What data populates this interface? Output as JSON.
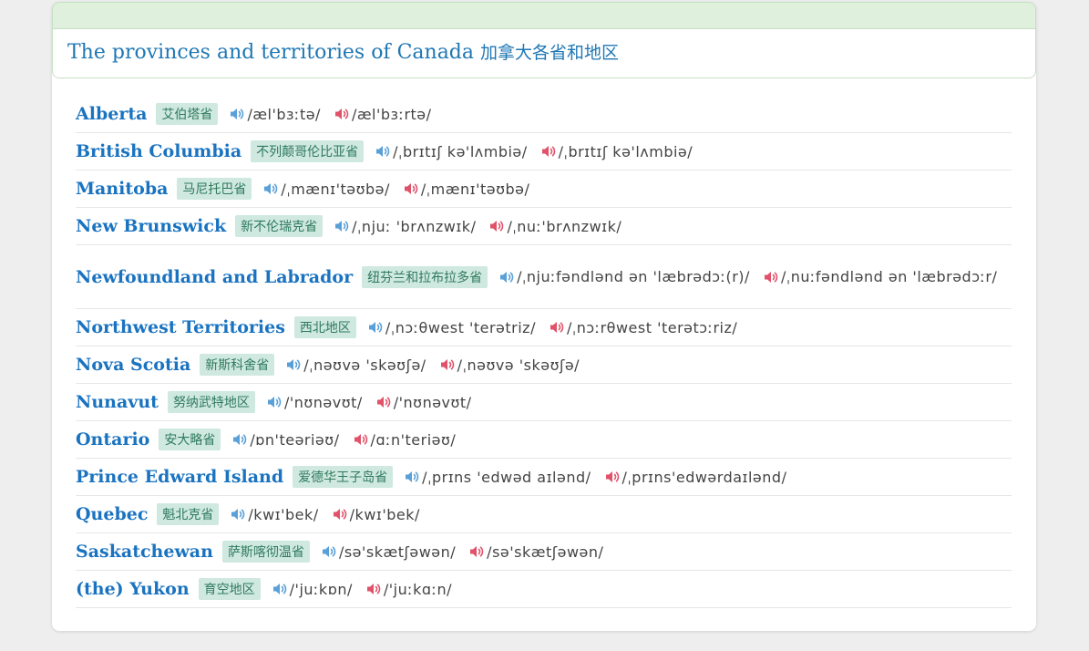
{
  "header": {
    "title_en": "The provinces and territories of Canada",
    "title_zh": "加拿大各省和地区"
  },
  "colors": {
    "uk_speaker": "#5aa0d8",
    "us_speaker": "#e0526a"
  },
  "icons": {
    "uk": "speaker-uk-icon",
    "us": "speaker-us-icon"
  },
  "provinces": [
    {
      "name": "Alberta",
      "zh": "艾伯塔省",
      "uk": "/æl'bɜːtə/",
      "us": "/æl'bɜːrtə/"
    },
    {
      "name": "British Columbia",
      "zh": "不列颠哥伦比亚省",
      "uk": "/ˌbrɪtɪʃ kə'lʌmbiə/",
      "us": "/ˌbrɪtɪʃ kə'lʌmbiə/"
    },
    {
      "name": "Manitoba",
      "zh": "马尼托巴省",
      "uk": "/ˌmænɪ'təʊbə/",
      "us": "/ˌmænɪ'təʊbə/"
    },
    {
      "name": "New Brunswick",
      "zh": "新不伦瑞克省",
      "uk": "/ˌnjuː 'brʌnzwɪk/",
      "us": "/ˌnuː'brʌnzwɪk/"
    },
    {
      "name": "Newfoundland and Labrador",
      "zh": "纽芬兰和拉布拉多省",
      "uk": "/ˌnjuːfəndlənd ən 'læbrədɔː(r)/",
      "us": "/ˌnuːfəndlənd ən 'læbrədɔːr/"
    },
    {
      "name": "Northwest Territories",
      "zh": "西北地区",
      "uk": "/ˌnɔːθwest 'terətriz/",
      "us": "/ˌnɔːrθwest 'terətɔːriz/"
    },
    {
      "name": "Nova Scotia",
      "zh": "新斯科舍省",
      "uk": "/ˌnəʊvə 'skəʊʃə/",
      "us": "/ˌnəʊvə 'skəʊʃə/"
    },
    {
      "name": "Nunavut",
      "zh": "努纳武特地区",
      "uk": "/'nʊnəvʊt/",
      "us": "/'nʊnəvʊt/"
    },
    {
      "name": "Ontario",
      "zh": "安大略省",
      "uk": "/ɒn'teəriəʊ/",
      "us": "/ɑːn'teriəʊ/"
    },
    {
      "name": "Prince Edward Island",
      "zh": "爱德华王子岛省",
      "uk": "/ˌprɪns 'edwəd aɪlənd/",
      "us": "/ˌprɪns'edwərdaɪlənd/"
    },
    {
      "name": "Quebec",
      "zh": "魁北克省",
      "uk": "/kwɪ'bek/",
      "us": "/kwɪ'bek/"
    },
    {
      "name": "Saskatchewan",
      "zh": "萨斯喀彻温省",
      "uk": "/sə'skætʃəwən/",
      "us": "/sə'skætʃəwən/"
    },
    {
      "name": "(the) Yukon",
      "zh": "育空地区",
      "uk": "/'juːkɒn/",
      "us": "/'juːkɑːn/"
    }
  ]
}
